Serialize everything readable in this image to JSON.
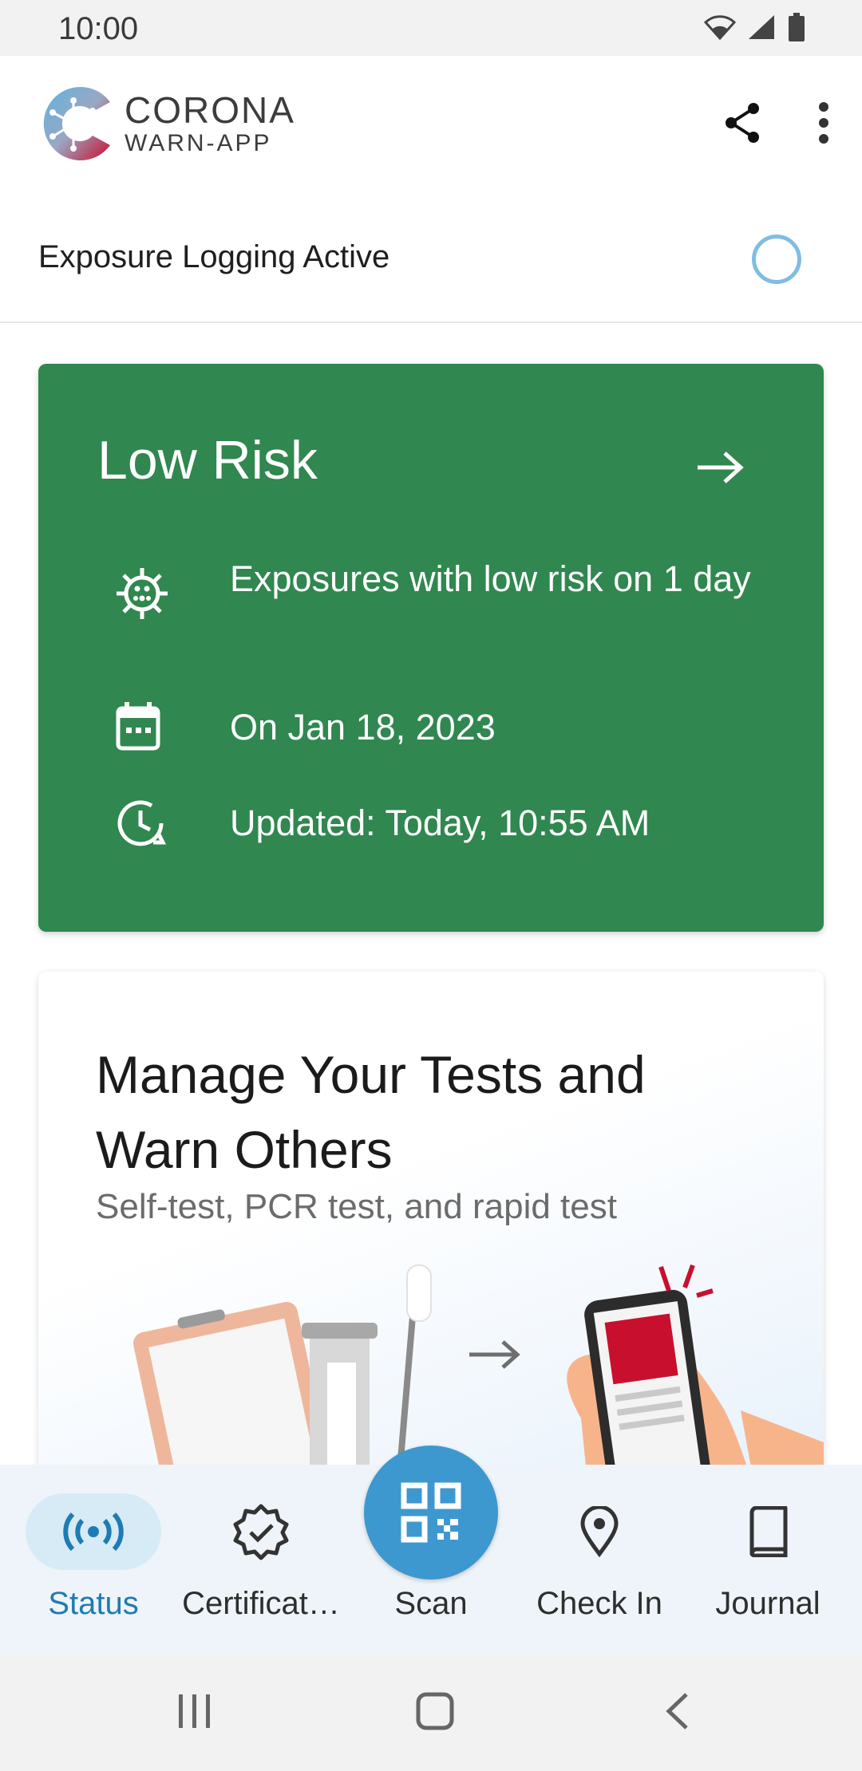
{
  "status_bar": {
    "time": "10:00"
  },
  "app": {
    "logo_title": "CORONA",
    "logo_subtitle": "WARN-APP"
  },
  "header": {
    "share_icon": "share-icon",
    "menu_icon": "more-vert-icon"
  },
  "exposure": {
    "label": "Exposure Logging Active"
  },
  "risk_card": {
    "title": "Low Risk",
    "color": "#30874f",
    "rows": [
      {
        "icon": "virus-icon",
        "text": "Exposures with low risk on 1 day"
      },
      {
        "icon": "calendar-icon",
        "text": "On Jan 18, 2023"
      },
      {
        "icon": "clock-refresh-icon",
        "text": "Updated: Today, 10:55 AM"
      }
    ]
  },
  "test_card": {
    "title": "Manage Your Tests and Warn Others",
    "subtitle": "Self-test, PCR test, and rapid test"
  },
  "bottom_nav": {
    "active": "Status",
    "accent": "#1f7bb3",
    "items": [
      {
        "label": "Status",
        "icon": "broadcast-icon"
      },
      {
        "label": "Certificat…",
        "icon": "certificate-icon"
      },
      {
        "label": "Scan",
        "icon": "qr-code-icon"
      },
      {
        "label": "Check In",
        "icon": "location-pin-icon"
      },
      {
        "label": "Journal",
        "icon": "book-icon"
      }
    ]
  }
}
